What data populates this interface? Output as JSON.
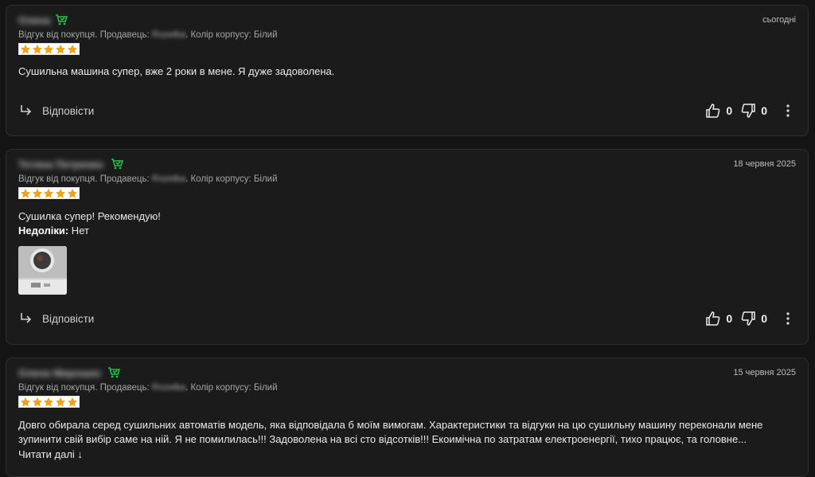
{
  "reviews": [
    {
      "author": "Олена",
      "date": "сьогодні",
      "meta_prefix": "Відгук від покупця. Продавець: ",
      "seller": "Rozetka",
      "meta_suffix": ". Колір корпусу: Білий",
      "rating": 5,
      "text": "Сушильна машина супер, вже 2 роки в мене. Я дуже задоволена.",
      "reply_label": "Відповісти",
      "likes": "0",
      "dislikes": "0"
    },
    {
      "author": "Тетяна Петренко",
      "date": "18 червня 2025",
      "meta_prefix": "Відгук від покупця. Продавець: ",
      "seller": "Rozetka",
      "meta_suffix": ". Колір корпусу: Білий",
      "rating": 5,
      "text": "Сушилка супер! Рекомендую!",
      "cons_label": "Недоліки:",
      "cons_value": " Нет",
      "reply_label": "Відповісти",
      "likes": "0",
      "dislikes": "0"
    },
    {
      "author": "Олена Мирошко",
      "date": "15 червня 2025",
      "meta_prefix": "Відгук від покупця. Продавець: ",
      "seller": "Rozetka",
      "meta_suffix": ". Колір корпусу: Білий",
      "rating": 5,
      "text_line1": "Довго обирала серед сушильних автоматів модель, яка відповідала б моїм вимогам. Характеристики та відгуки на цю сушильну машину переконали мене",
      "text_line2": "зупинити свій вибір саме на ній. Я не помилилась!!! Задоволена на всі сто відсотків!!! Екоимічна по затратам електроенергії, тихо працює, та головне...",
      "read_more": "Читати далі ↓"
    }
  ],
  "colors": {
    "star": "#f0a21b",
    "badge": "#27c24c",
    "background": "#141414",
    "card": "#1b1b1c"
  },
  "icons": [
    "verified-buyer-icon",
    "reply-arrow-icon",
    "thumbs-up-icon",
    "thumbs-down-icon",
    "more-vertical-icon",
    "star-icon"
  ]
}
